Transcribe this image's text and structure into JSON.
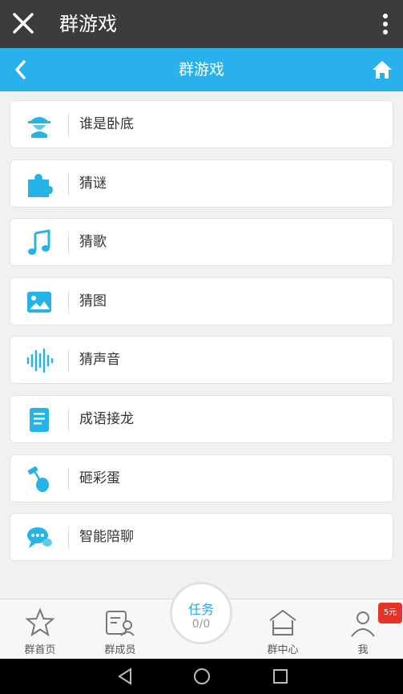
{
  "topbar": {
    "title": "群游戏"
  },
  "navbar": {
    "title": "群游戏"
  },
  "games": [
    {
      "label": "谁是卧底",
      "icon": "spy-icon"
    },
    {
      "label": "猜谜",
      "icon": "puzzle-icon"
    },
    {
      "label": "猜歌",
      "icon": "music-note-icon"
    },
    {
      "label": "猜图",
      "icon": "picture-icon"
    },
    {
      "label": "猜声音",
      "icon": "sound-wave-icon"
    },
    {
      "label": "成语接龙",
      "icon": "book-icon"
    },
    {
      "label": "砸彩蛋",
      "icon": "hammer-egg-icon"
    },
    {
      "label": "智能陪聊",
      "icon": "chat-bubble-icon"
    }
  ],
  "tabbar": {
    "home": "群首页",
    "members": "群成员",
    "task_title": "任务",
    "task_progress": "0/0",
    "center": "群中心",
    "me": "我",
    "badge": "5元"
  },
  "colors": {
    "accent": "#28b1ec",
    "dark": "#3c3c3c"
  }
}
